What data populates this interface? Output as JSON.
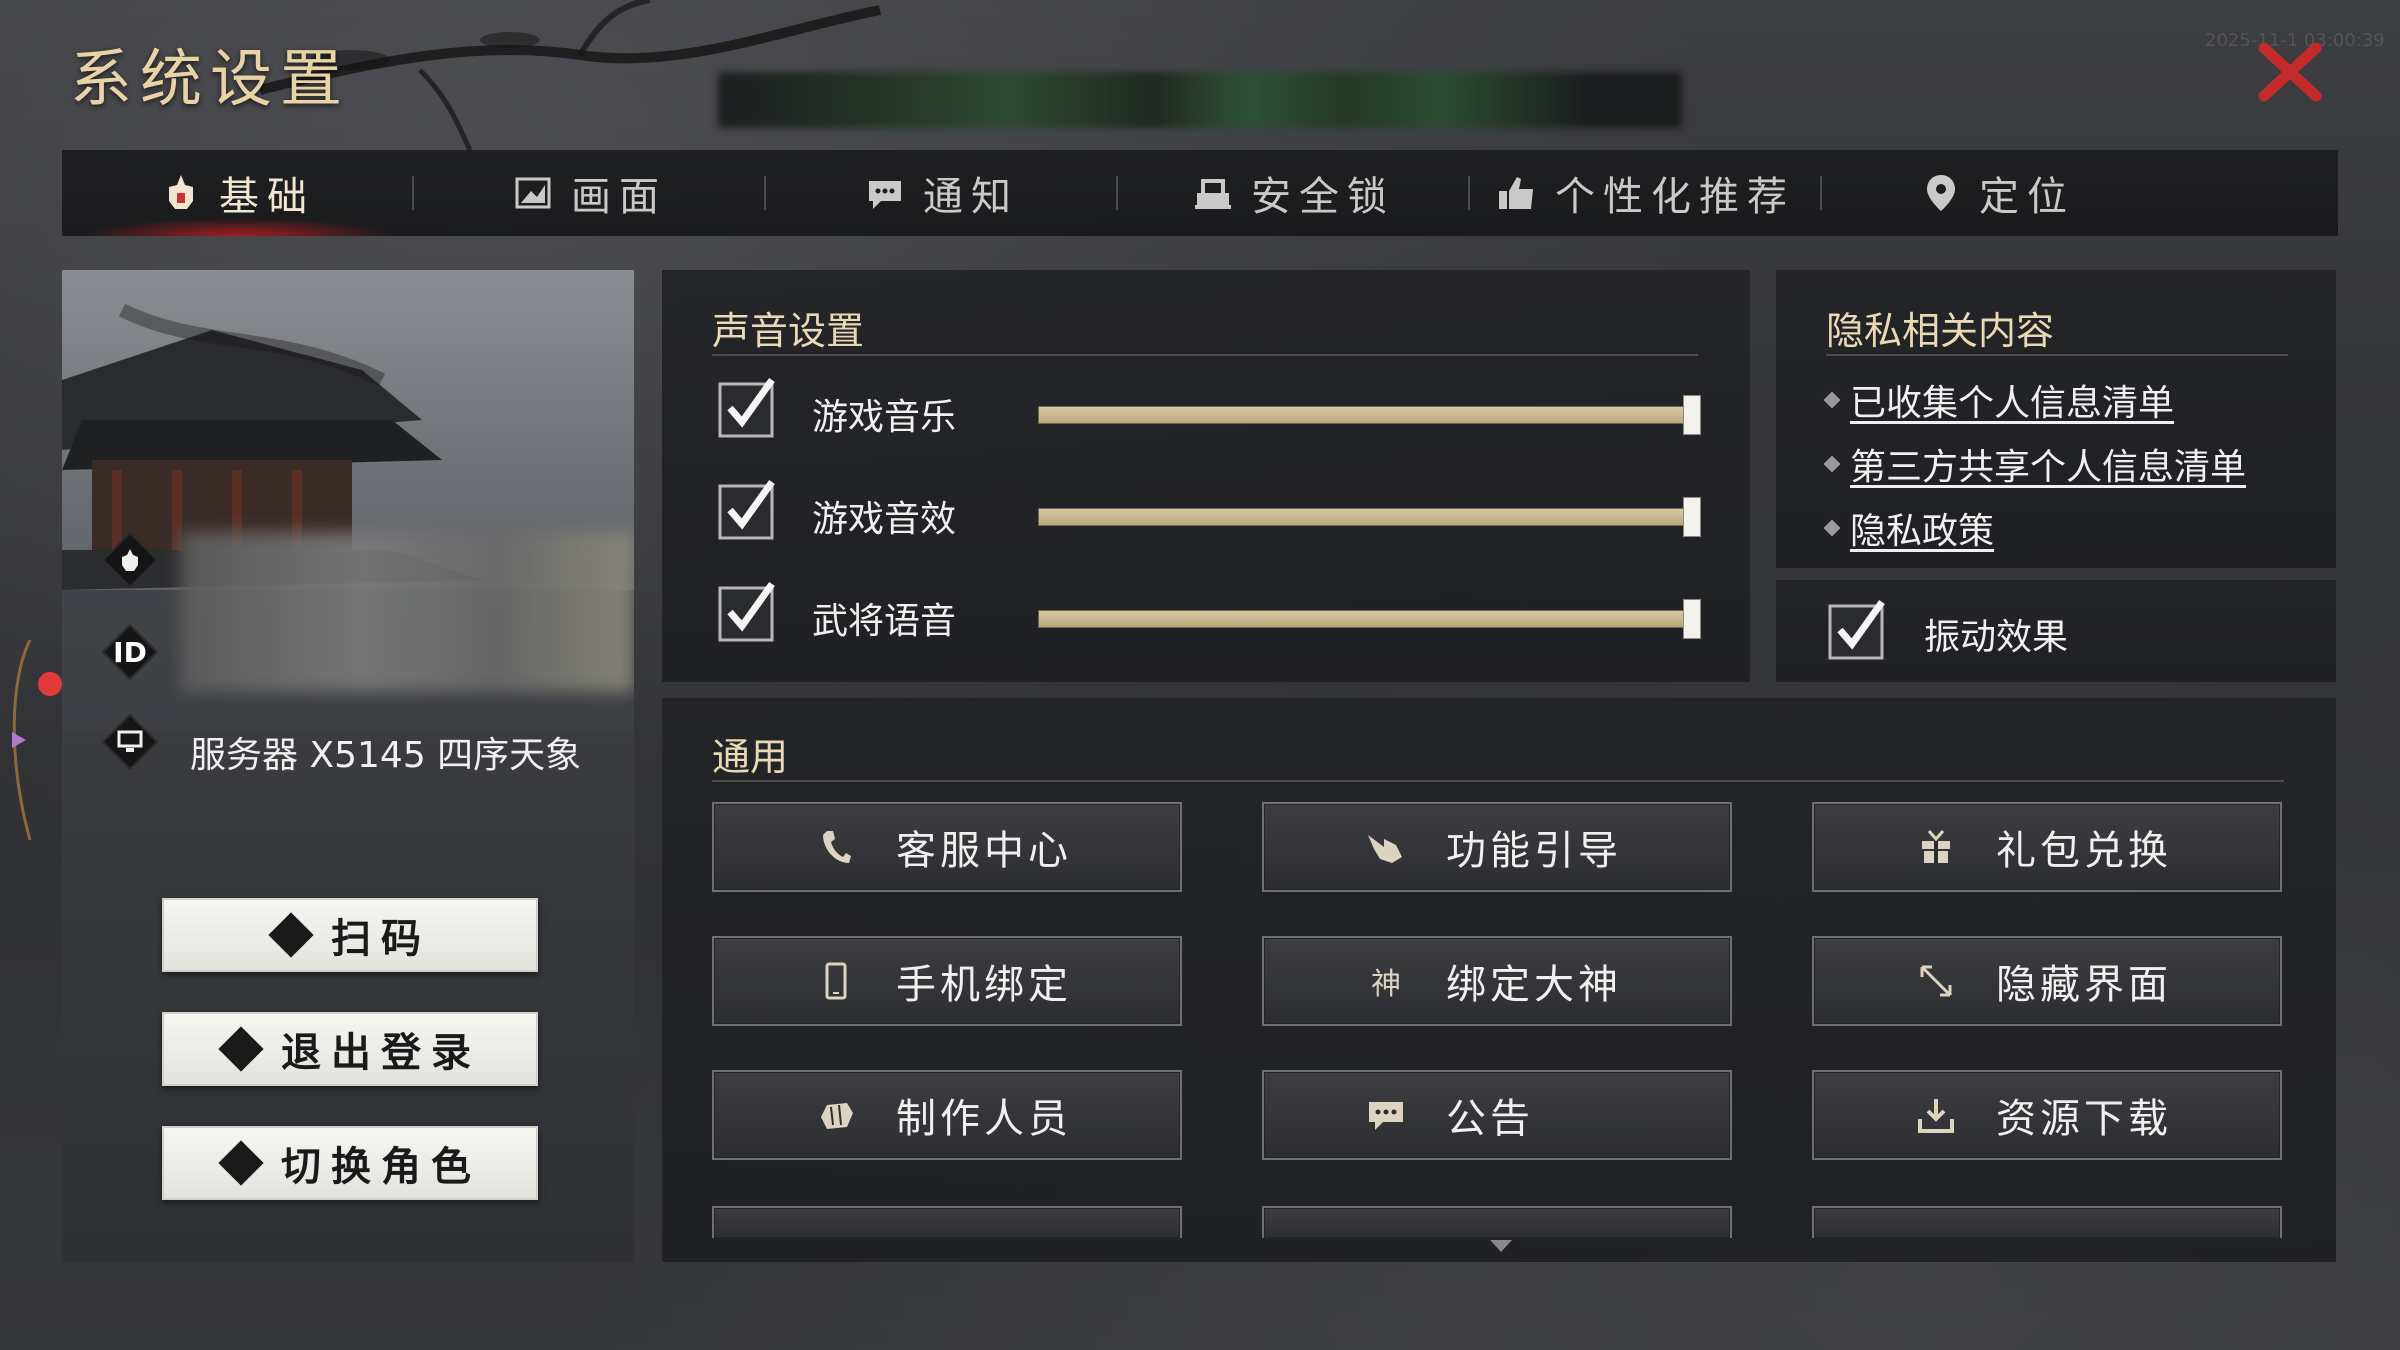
{
  "window": {
    "title": "系统设置",
    "timestamp": "2025-11-1 03:00:39"
  },
  "tabs": [
    {
      "label": "基础",
      "icon": "helmet-icon",
      "active": true
    },
    {
      "label": "画面",
      "icon": "picture-icon",
      "active": false
    },
    {
      "label": "通知",
      "icon": "chat-bubble-icon",
      "active": false
    },
    {
      "label": "安全锁",
      "icon": "lock-icon",
      "active": false
    },
    {
      "label": "个性化推荐",
      "icon": "thumbs-up-icon",
      "active": false
    },
    {
      "label": "定位",
      "icon": "location-pin-icon",
      "active": false
    }
  ],
  "profile": {
    "server_text": "服务器 X5145 四序天象",
    "id_badge": "ID",
    "buttons": {
      "scan": "扫码",
      "logout": "退出登录",
      "switch_role": "切换角色"
    }
  },
  "sound": {
    "title": "声音设置",
    "items": [
      {
        "label": "游戏音乐",
        "checked": true,
        "level": 1.0
      },
      {
        "label": "游戏音效",
        "checked": true,
        "level": 1.0
      },
      {
        "label": "武将语音",
        "checked": true,
        "level": 1.0
      }
    ]
  },
  "privacy": {
    "title": "隐私相关内容",
    "links": [
      "已收集个人信息清单",
      "第三方共享个人信息清单",
      "隐私政策"
    ]
  },
  "vibration": {
    "label": "振动效果",
    "checked": true
  },
  "general": {
    "title": "通用",
    "buttons": [
      {
        "label": "客服中心",
        "icon": "phone-icon"
      },
      {
        "label": "功能引导",
        "icon": "pointing-hand-icon"
      },
      {
        "label": "礼包兑换",
        "icon": "gift-icon"
      },
      {
        "label": "手机绑定",
        "icon": "mobile-icon"
      },
      {
        "label": "绑定大神",
        "icon": "shen-char-icon",
        "glyph": "神"
      },
      {
        "label": "隐藏界面",
        "icon": "resize-arrow-icon"
      },
      {
        "label": "制作人员",
        "icon": "fist-icon"
      },
      {
        "label": "公告",
        "icon": "message-icon"
      },
      {
        "label": "资源下载",
        "icon": "download-icon"
      }
    ]
  },
  "colors": {
    "accent_gold": "#e9d9b5",
    "close_red": "#c42a2a",
    "active_tab_glow": "#be1e1e",
    "slider_fill": "#c9b68d"
  }
}
